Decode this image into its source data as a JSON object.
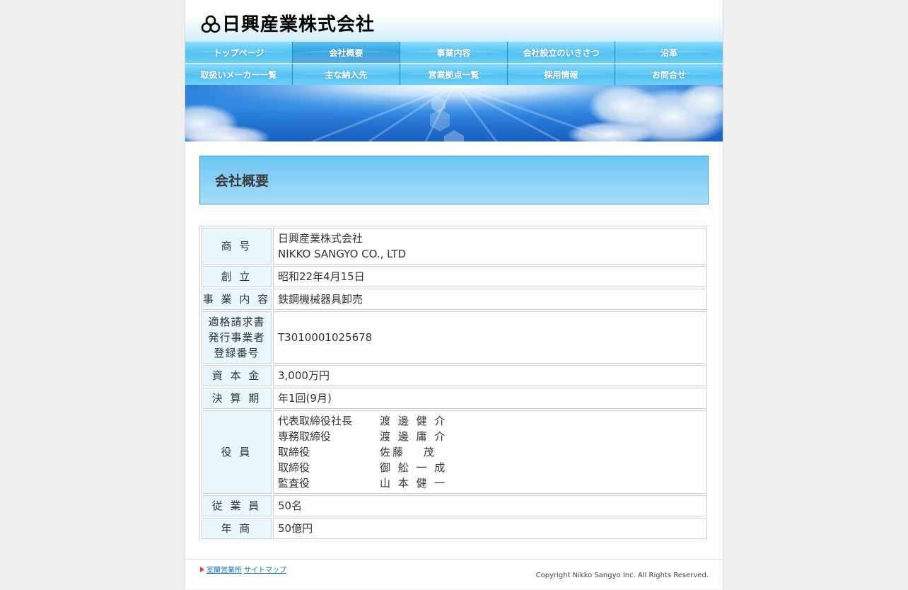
{
  "header": {
    "company_name": "日興産業株式会社"
  },
  "nav": {
    "row1": [
      "トップページ",
      "会社概要",
      "事業内容",
      "会社設立のいきさつ",
      "沿革"
    ],
    "row2": [
      "取扱いメーカー一覧",
      "主な納入先",
      "営業拠点一覧",
      "採用情報",
      "お問合せ"
    ],
    "active": "会社概要"
  },
  "page": {
    "title": "会社概要"
  },
  "profile": {
    "shogo_label": "商 号",
    "shogo_value_ja": "日興産業株式会社",
    "shogo_value_en": "NIKKO SANGYO CO., LTD",
    "soritsu_label": "創 立",
    "soritsu_value": "昭和22年4月15日",
    "jigyo_label": "事 業 内 容",
    "jigyo_value": "鉄鋼機械器具卸売",
    "tekikaku_label_1": "適格請求書",
    "tekikaku_label_2": "発行事業者",
    "tekikaku_label_3": "登録番号",
    "tekikaku_value": "T3010001025678",
    "shihon_label": "資 本 金",
    "shihon_value": "3,000万円",
    "kessan_label": "決 算 期",
    "kessan_value": "年1回(9月)",
    "yakuin_label": "役 員",
    "officers": [
      {
        "title": "代表取締役社長",
        "name": "渡 邊 健 介"
      },
      {
        "title": "専務取締役",
        "name": "渡 邊 庸 介"
      },
      {
        "title": "取締役",
        "name": "佐藤　 茂"
      },
      {
        "title": "取締役",
        "name": "御 舩 一 成"
      },
      {
        "title": "監査役",
        "name": "山 本 健 一"
      }
    ],
    "jugyoin_label": "従 業 員",
    "jugyoin_value": "50名",
    "nensho_label": "年 商",
    "nensho_value": "50億円"
  },
  "footer": {
    "link1": "室蘭営業所",
    "link2": "サイトマップ",
    "copyright": "Copyright Nikko Sangyo Inc. All Rights Reserved."
  },
  "colors": {
    "nav_blue": "#2fb4ee",
    "nav_active": "#1a8fd3",
    "title_box": "#6cc6f2",
    "th_bg": "#e8f7fc"
  }
}
